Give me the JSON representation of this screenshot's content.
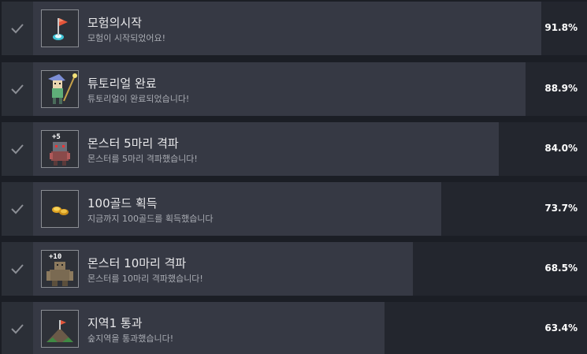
{
  "achievements": [
    {
      "title": "모험의시작",
      "description": "모험이 시작되었어요!",
      "percent_label": "91.8%",
      "percent": 91.8,
      "icon": "flag-start-icon"
    },
    {
      "title": "튜토리얼 완료",
      "description": "튜토리얼이 완료되었습니다!",
      "percent_label": "88.9%",
      "percent": 88.9,
      "icon": "hero-character-icon"
    },
    {
      "title": "몬스터 5마리 격파",
      "description": "몬스터를 5마리 격파했습니다!",
      "percent_label": "84.0%",
      "percent": 84.0,
      "icon": "monster-plus5-icon",
      "icon_text": "+5"
    },
    {
      "title": "100골드 획득",
      "description": "지금까지 100골드를 획득했습니다",
      "percent_label": "73.7%",
      "percent": 73.7,
      "icon": "gold-coins-icon"
    },
    {
      "title": "몬스터 10마리 격파",
      "description": "몬스터를 10마리 격파했습니다!",
      "percent_label": "68.5%",
      "percent": 68.5,
      "icon": "ogre-plus10-icon",
      "icon_text": "+10"
    },
    {
      "title": "지역1 통과",
      "description": "숲지역을 통과했습니다!",
      "percent_label": "63.4%",
      "percent": 63.4,
      "icon": "mountain-flag-icon"
    }
  ],
  "colors": {
    "row_bg": "#23262e",
    "progress_fill": "#363944",
    "check_cell": "#2b2f37",
    "check_mark": "#8b8e95"
  }
}
